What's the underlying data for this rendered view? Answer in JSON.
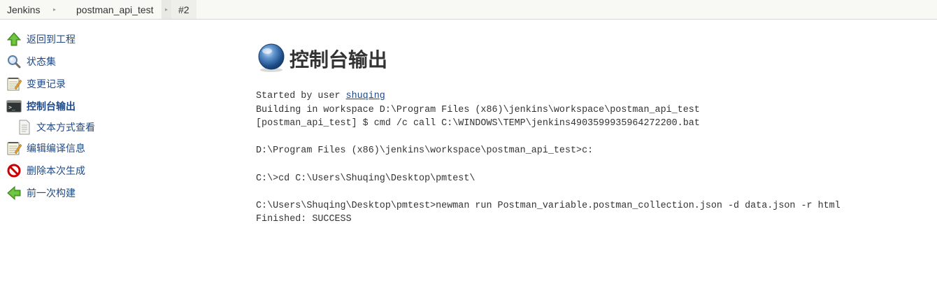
{
  "breadcrumb": {
    "items": [
      "Jenkins",
      "postman_api_test",
      "#2"
    ]
  },
  "sidebar": {
    "items": [
      {
        "label": "返回到工程",
        "icon": "up-arrow-icon"
      },
      {
        "label": "状态集",
        "icon": "search-icon"
      },
      {
        "label": "变更记录",
        "icon": "notepad-icon"
      },
      {
        "label": "控制台输出",
        "icon": "terminal-icon"
      },
      {
        "label": "文本方式查看",
        "icon": "document-icon"
      },
      {
        "label": "编辑编译信息",
        "icon": "notepad-icon"
      },
      {
        "label": "删除本次生成",
        "icon": "no-entry-icon"
      },
      {
        "label": "前一次构建",
        "icon": "left-arrow-icon"
      }
    ]
  },
  "main": {
    "title": "控制台输出",
    "title_icon": "globe-icon"
  },
  "console": {
    "started_prefix": "Started by user ",
    "user": "shuqing",
    "lines": [
      "Building in workspace D:\\Program Files (x86)\\jenkins\\workspace\\postman_api_test",
      "[postman_api_test] $ cmd /c call C:\\WINDOWS\\TEMP\\jenkins4903599935964272200.bat",
      "",
      "D:\\Program Files (x86)\\jenkins\\workspace\\postman_api_test>c:",
      "",
      "C:\\>cd C:\\Users\\Shuqing\\Desktop\\pmtest\\",
      "",
      "C:\\Users\\Shuqing\\Desktop\\pmtest>newman run Postman_variable.postman_collection.json -d data.json -r html",
      "Finished: SUCCESS"
    ]
  },
  "colors": {
    "link": "#204a87",
    "breadcrumb_bg": "#f8f8f4",
    "text": "#333333"
  }
}
